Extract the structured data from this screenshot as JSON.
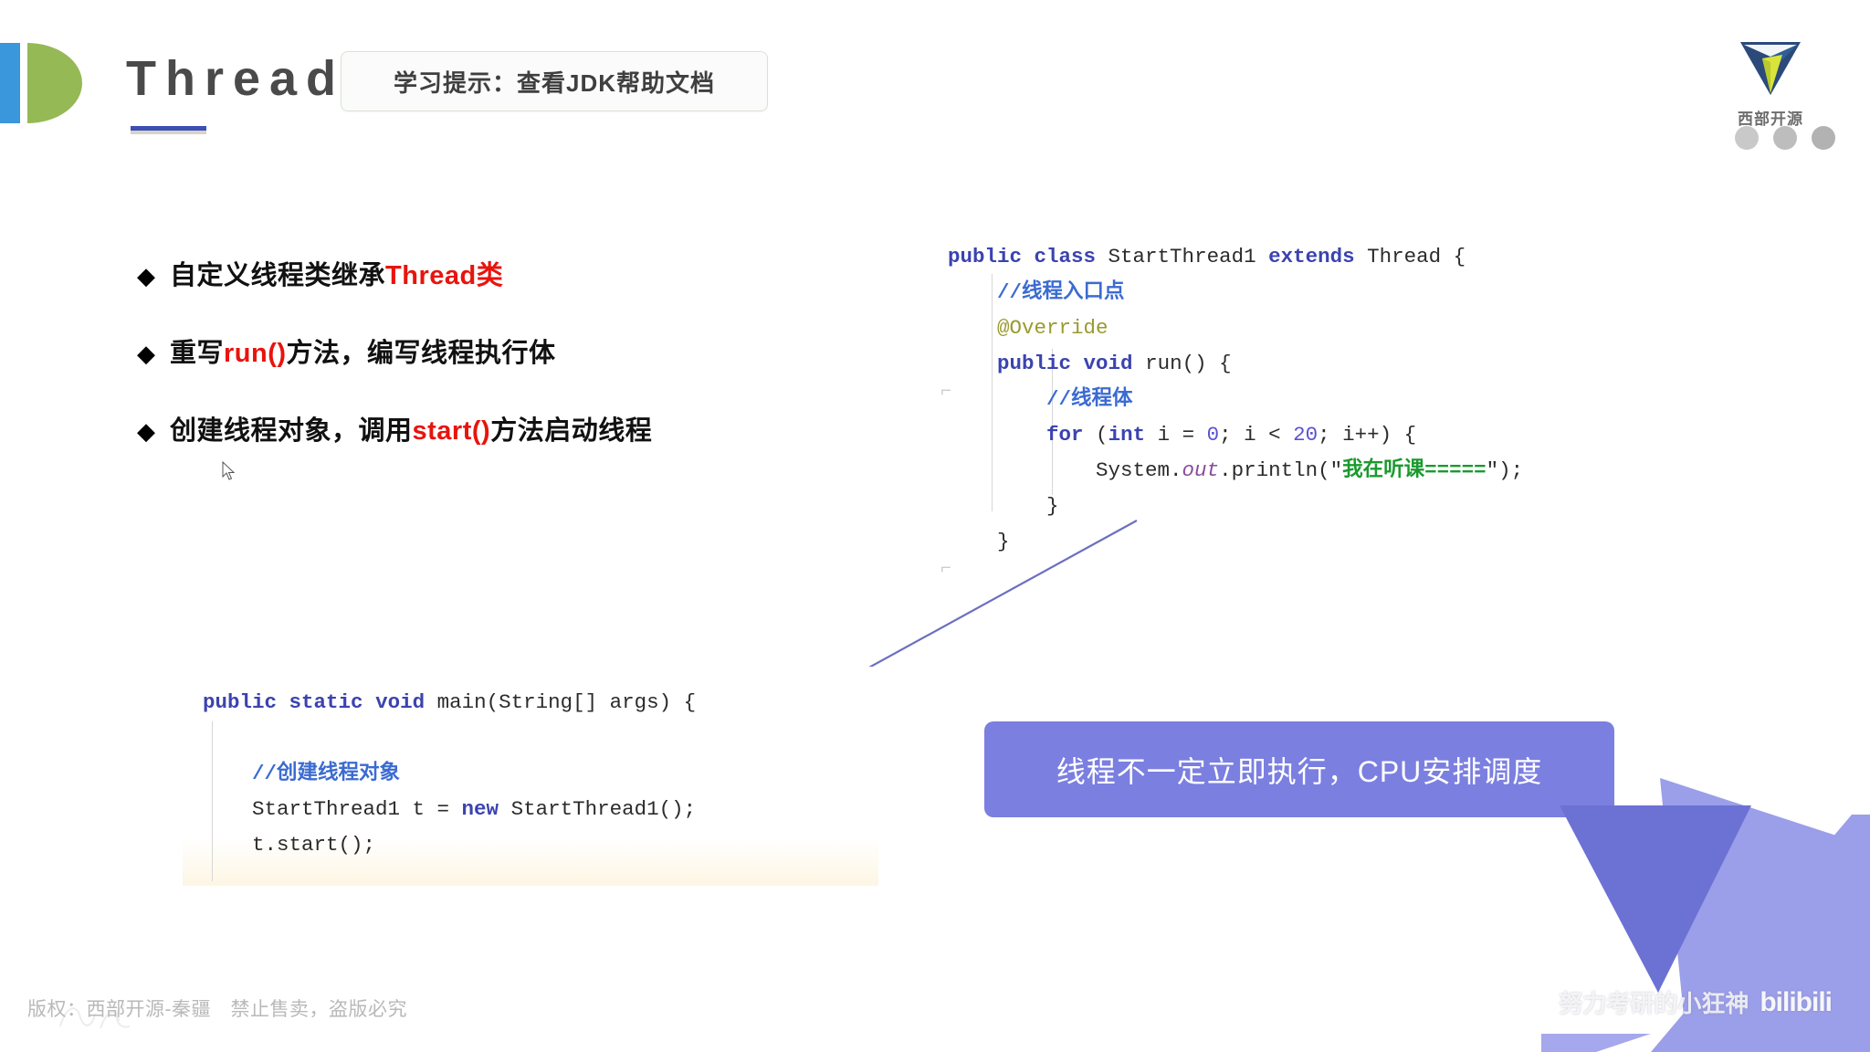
{
  "header": {
    "title": "Thread",
    "tip_badge": "学习提示：查看JDK帮助文档",
    "logo_icon": "d-letter-logo",
    "brand_name": "西部开源",
    "brand_icon": "triangle-brand-icon"
  },
  "bullets": [
    {
      "marker": "◆",
      "plain1": "自定义线程类继承",
      "highlight": "Thread类",
      "plain2": ""
    },
    {
      "marker": "◆",
      "plain1": "重写",
      "highlight": "run()",
      "plain2": "方法，编写线程执行体"
    },
    {
      "marker": "◆",
      "plain1": "创建线程对象，调用",
      "highlight": "start()",
      "plain2": "方法启动线程"
    }
  ],
  "code_top": {
    "lines": [
      "public class StartThread1 extends Thread {",
      "    //线程入口点",
      "    @Override",
      "    public void run() {",
      "        //线程体",
      "        for (int i = 0; i < 20; i++) {",
      "            System.out.println(\"我在听课=====\");",
      "        }",
      "    }"
    ],
    "string_literal": "我在听课=====",
    "loop_limit": "20",
    "loop_start": "0",
    "class_name": "StartThread1",
    "super_class": "Thread"
  },
  "code_bottom": {
    "lines": [
      "public static void main(String[] args) {",
      "",
      "    //创建线程对象",
      "    StartThread1 t = new StartThread1();",
      "    t.start();"
    ],
    "comment": "//创建线程对象",
    "var_name": "t"
  },
  "callout": {
    "text": "线程不一定立即执行，CPU安排调度",
    "color": "#7b7fe0"
  },
  "footer": {
    "copyright": "版权：西部开源-秦疆　禁止售卖，盗版必究"
  },
  "watermark": {
    "text": "努力考研的小狂神",
    "logo": "bilibili"
  },
  "colors": {
    "accent_red": "#e8140d",
    "accent_blue": "#3b43b0",
    "logo_green": "#95b955",
    "logo_blue": "#3a97db",
    "callout_purple": "#7b7fe0",
    "string_green": "#1a9a2e"
  }
}
